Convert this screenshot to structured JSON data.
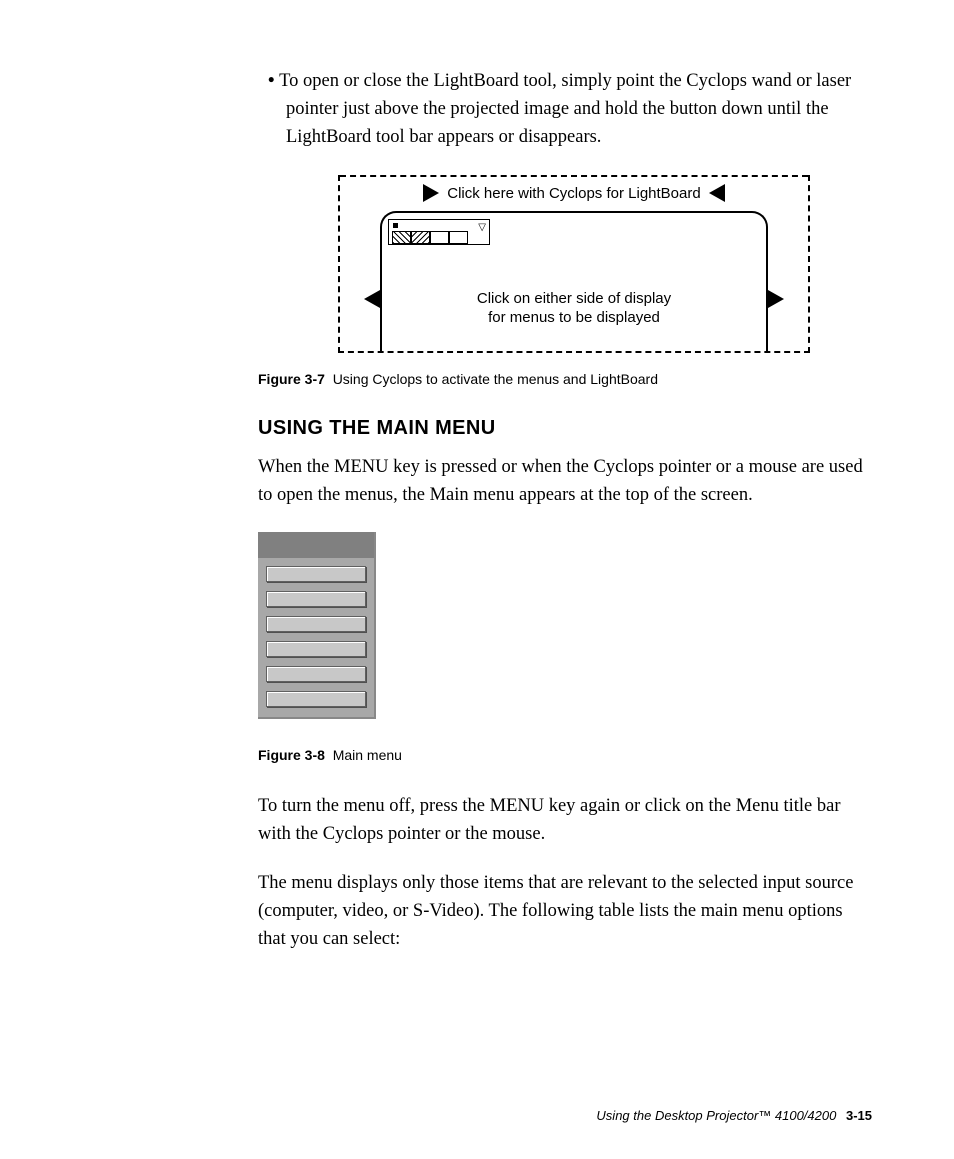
{
  "bullet": "To open or close the LightBoard tool, simply point the Cyclops wand or laser pointer just above the projected image and hold the button down until the LightBoard tool bar appears or disappears.",
  "fig37": {
    "top_label": "Click here with Cyclops for LightBoard",
    "bottom_label_line1": "Click on either side of display",
    "bottom_label_line2": "for menus to be displayed",
    "caption_label": "Figure 3-7",
    "caption_text": "Using Cyclops to activate the menus and LightBoard"
  },
  "heading": "USING THE MAIN MENU",
  "para1": "When the MENU key is pressed or when the Cyclops pointer or a mouse are used to open the menus, the Main menu appears at the top of the screen.",
  "fig38": {
    "caption_label": "Figure 3-8",
    "caption_text": "Main menu",
    "item_count": 6
  },
  "para2": "To turn the menu off, press the MENU key again or click on the Menu title bar with the Cyclops pointer or the mouse.",
  "para3": "The menu displays only those items that are relevant to the selected input source (computer, video, or S-Video). The following table lists the main menu options that you can select:",
  "footer": {
    "title": "Using the Desktop Projector™ 4100/4200",
    "page": "3-15"
  }
}
